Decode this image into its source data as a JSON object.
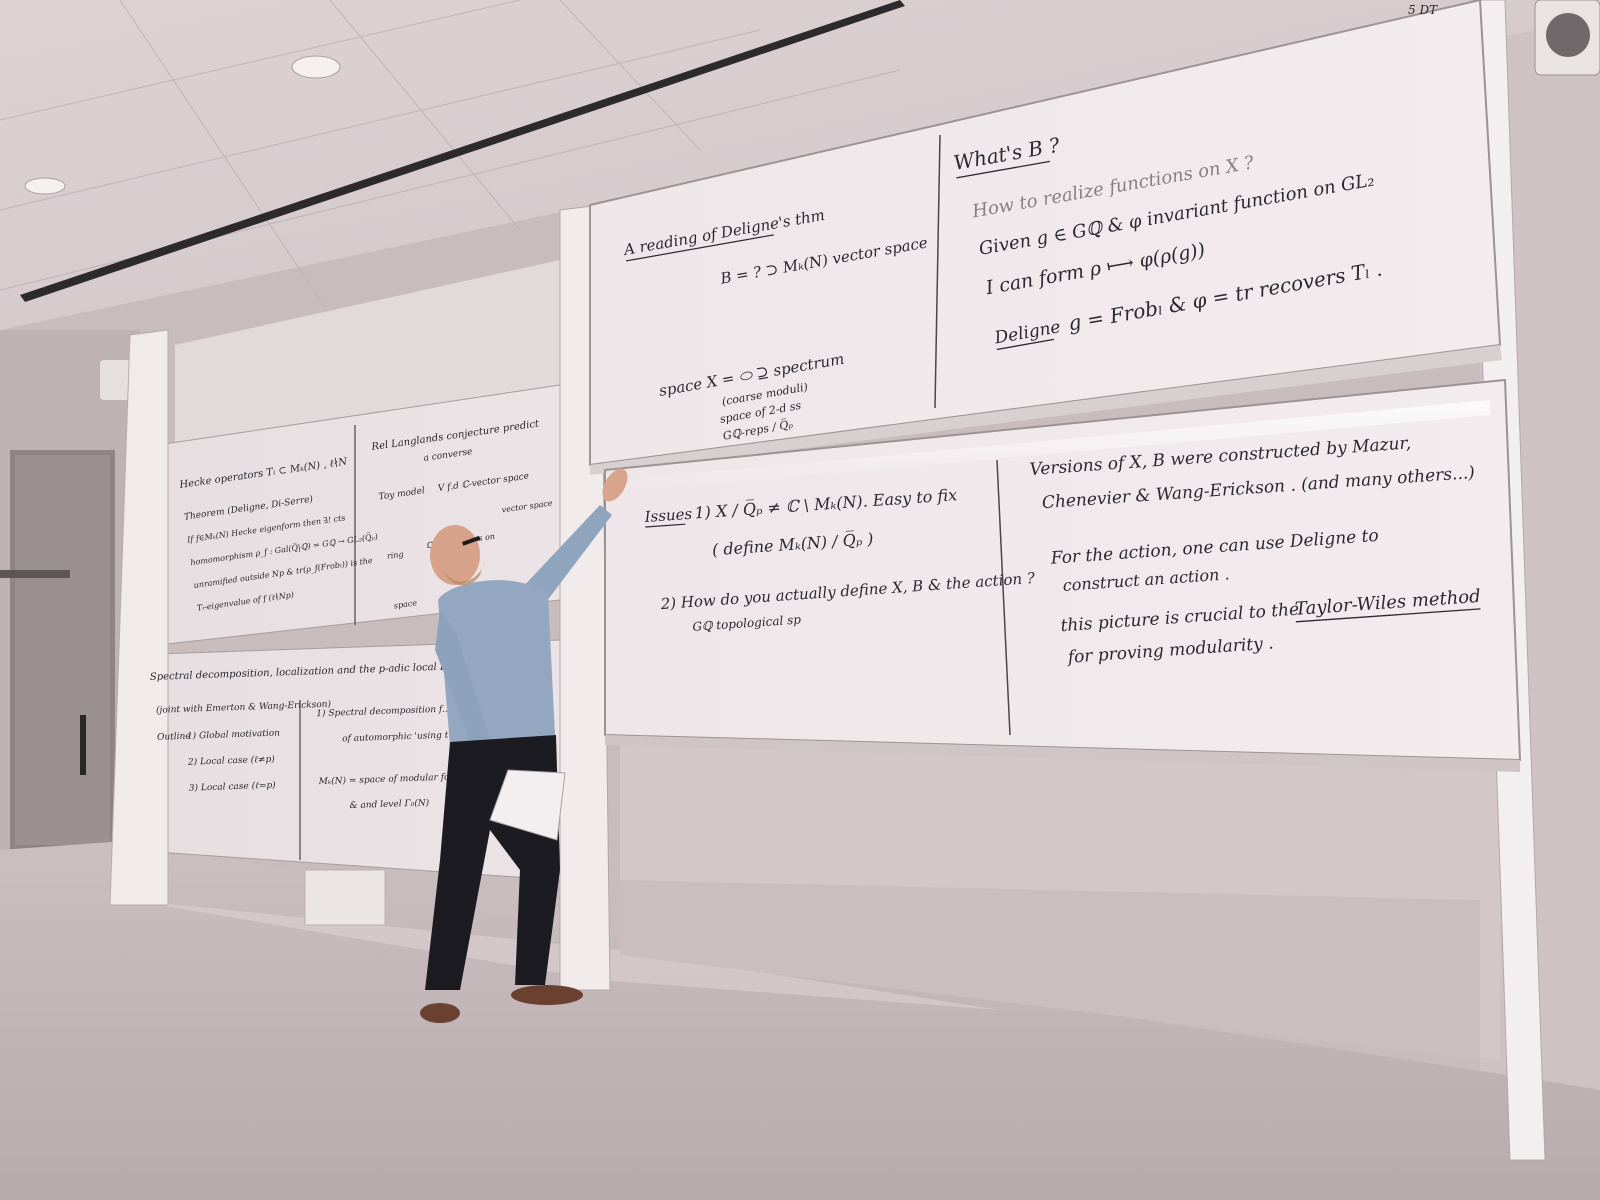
{
  "scene": {
    "description_tag": "lecture-room-photo"
  },
  "corner_note": "5\nDT",
  "board_upper_left": {
    "title": "A reading of Deligne's thm",
    "line1": "B = ?   ⊃   Mₖ(N)   vector space",
    "line2": "space  X = ⬭   ⊇   spectrum",
    "note1": "(coarse moduli)",
    "note2": "space of 2-d ss",
    "note3": "Gℚ-reps / Q̅ₚ"
  },
  "board_upper_right": {
    "title": "What's B ?",
    "line1": "How to realize functions on X ?",
    "line2": "Given  g ∈ Gℚ  &  φ invariant function on GL₂",
    "line3": "I can form   ρ ⟼ φ(ρ(g))",
    "line4_label": "Deligne",
    "line4": "g = Frobₗ  &  φ = tr  recovers Tₗ ."
  },
  "board_lower_left": {
    "label": "Issues",
    "line1": "1)  X / Q̅ₚ ≠ ℂ \\ Mₖ(N).  Easy to fix",
    "line2": "( define Mₖ(N) / Q̅ₚ )",
    "line3": "2)  How do you actually define X, B & the action ?",
    "line4": "Gℚ topological sp"
  },
  "board_lower_right": {
    "line1": "Versions of X, B were constructed by Mazur,",
    "line2": "Chenevier & Wang-Erickson . (and many others...)",
    "line3": "For the action, one can use Deligne to",
    "line4": "construct an action .",
    "line5_a": "this picture is crucial to the",
    "line5_b": "Taylor-Wiles method",
    "line6": "for proving modularity ."
  },
  "board_back_upper": {
    "left_title": "Hecke operators  Tₗ ⊂ Mₖ(N) ,  ℓ∤N",
    "left_theorem": "Theorem  (Deligne, Di-Serre)",
    "left_l2": "If f∈Mₖ(N) Hecke eigenform then ∃! cts",
    "left_l3": "homomorphism ρ_f : Gal(Q̅|ℚ) = Gℚ → GL₂(Q̅ₚ)",
    "left_l4": "unramified outside Np  &  tr(ρ_f(Frobₗ)) is the",
    "left_l5": "Tₗ-eigenvalue of f   (ℓ∤Np)",
    "right_title": "Rel  Langlands conjecture predict",
    "right_sub": "a converse",
    "right_toy": "Toy model",
    "right_l1": "V  f.d  ℂ-vector space",
    "right_l2": "ℂ[ξ]  functions on",
    "right_l3": "ring",
    "right_l4": "space",
    "right_l5": "vector space"
  },
  "board_back_lower": {
    "title": "Spectral decomposition, localization  and the p-adic local Langlands corres",
    "sub": "(joint with Emerton & Wang-Erickson)",
    "outline": "Outline",
    "o1": "1)  Global motivation",
    "o2": "2)  Local case  (ℓ≠p)",
    "o3": "3)  Local case  (ℓ=p)",
    "r1": "1)  Spectral decomposition f...",
    "r2": "of automorphic  'using t...",
    "r3": "Mₖ(N)  =  space of modular form",
    "r4": "& and level Γ₀(N)"
  }
}
